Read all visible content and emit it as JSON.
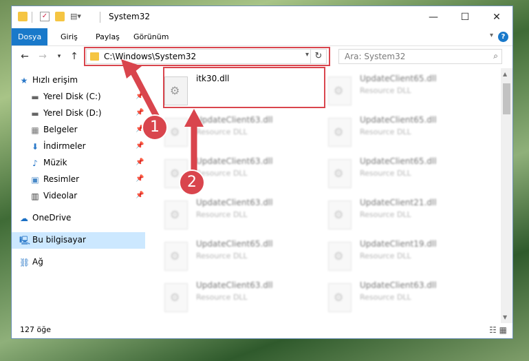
{
  "window": {
    "title": "System32"
  },
  "ribbon": {
    "tabs": [
      "Dosya",
      "Giriş",
      "Paylaş",
      "Görünüm"
    ]
  },
  "nav": {
    "address": "C:\\Windows\\System32",
    "search_placeholder": "Ara: System32"
  },
  "sidebar": {
    "items": [
      {
        "label": "Hızlı erişim",
        "icon": "star-icon"
      },
      {
        "label": "Yerel Disk (C:)",
        "icon": "drive-icon"
      },
      {
        "label": "Yerel Disk (D:)",
        "icon": "drive-icon"
      },
      {
        "label": "Belgeler",
        "icon": "documents-icon"
      },
      {
        "label": "İndirmeler",
        "icon": "download-icon"
      },
      {
        "label": "Müzik",
        "icon": "music-icon"
      },
      {
        "label": "Resimler",
        "icon": "pictures-icon"
      },
      {
        "label": "Videolar",
        "icon": "videos-icon"
      },
      {
        "label": "OneDrive",
        "icon": "cloud-icon"
      },
      {
        "label": "Bu bilgisayar",
        "icon": "computer-icon"
      },
      {
        "label": "Ağ",
        "icon": "network-icon"
      }
    ]
  },
  "files": [
    {
      "name": "itk30.dll",
      "type": ""
    },
    {
      "name": "UpdateClient65.dll",
      "type": "Resource DLL"
    },
    {
      "name": "UpdateClient63.dll",
      "type": "Resource DLL"
    },
    {
      "name": "UpdateClient65.dll",
      "type": "Resource DLL"
    },
    {
      "name": "UpdateClient63.dll",
      "type": "Resource DLL"
    },
    {
      "name": "UpdateClient65.dll",
      "type": "Resource DLL"
    },
    {
      "name": "UpdateClient63.dll",
      "type": "Resource DLL"
    },
    {
      "name": "UpdateClient21.dll",
      "type": "Resource DLL"
    },
    {
      "name": "UpdateClient65.dll",
      "type": "Resource DLL"
    },
    {
      "name": "UpdateClient19.dll",
      "type": "Resource DLL"
    },
    {
      "name": "UpdateClient63.dll",
      "type": "Resource DLL"
    },
    {
      "name": "UpdateClient63.dll",
      "type": "Resource DLL"
    }
  ],
  "status": {
    "count": "127 öğe"
  },
  "markers": [
    "1",
    "2"
  ],
  "colors": {
    "accent": "#1979ca",
    "highlight": "#d9454d",
    "selected": "#cce8ff"
  }
}
